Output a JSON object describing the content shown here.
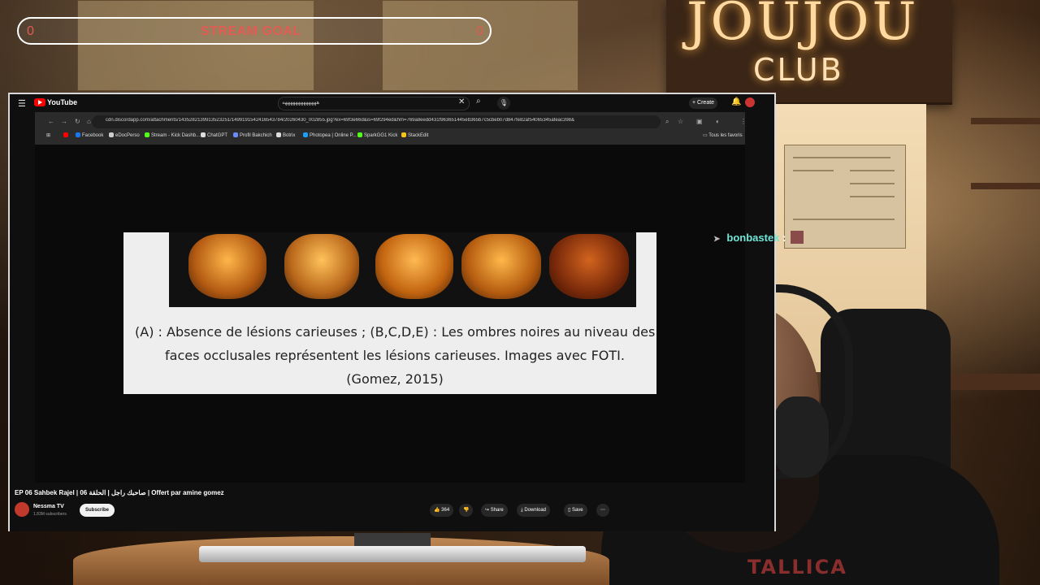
{
  "stream_goal": {
    "label": "STREAM GOAL",
    "current": "0",
    "target": "0"
  },
  "sign": {
    "line1": "JOUJOU",
    "line2": "CLUB"
  },
  "youtube": {
    "logo_text": "YouTube",
    "search_query": "هههههههههههههه",
    "create_label": "Create"
  },
  "browser": {
    "url": "cdn.discordapp.com/attachments/1435282139913523251/1499191542416543784/20260430_002855.jpg?ex=69f3e66d&is=69f294ed&hm=769a8eedd431f963651445eb365b7c5cbeb07d847fe82af54065345afeac398&",
    "bookmarks": [
      {
        "label": "",
        "color": "#ff0000"
      },
      {
        "label": "Facebook",
        "color": "#1877f2"
      },
      {
        "label": "eDocPerso",
        "color": "#cccccc"
      },
      {
        "label": "Stream - Kick Dashb...",
        "color": "#53fc18"
      },
      {
        "label": "ChatGPT",
        "color": "#dddddd"
      },
      {
        "label": "Profil Bakchich",
        "color": "#6b8cff"
      },
      {
        "label": "Botrix",
        "color": "#dddddd"
      },
      {
        "label": "Photopea | Online P...",
        "color": "#18a0fb"
      },
      {
        "label": "SparkGG1 Kick",
        "color": "#53fc18"
      },
      {
        "label": "StackEdit",
        "color": "#f5c518"
      }
    ],
    "all_bookmarks": "Tous les favoris"
  },
  "image": {
    "caption_line1": "(A) : Absence de lésions carieuses ; (B,C,D,E) : Les ombres noires au niveau des",
    "caption_line2": "faces occlusales représentent les lésions carieuses. Images avec FOTI.",
    "caption_line3": "(Gomez, 2015)"
  },
  "video": {
    "title": "EP 06 Sahbek Rajel | صاحبك راجل | الحلقة 06 | Offert par amine gomez",
    "channel": "Nessma TV",
    "subscribers": "1.83M subscribers",
    "subscribe": "Subscribe",
    "likes": "364",
    "share": "Share",
    "download": "Download",
    "save": "Save"
  },
  "chat": {
    "username": "bonbastek",
    "separator": ":"
  },
  "streamer_shirt": "TALLICA",
  "colors": {
    "goal_text": "#e25b52",
    "chat_user": "#6fe6d8",
    "yt_red": "#ff0000"
  }
}
